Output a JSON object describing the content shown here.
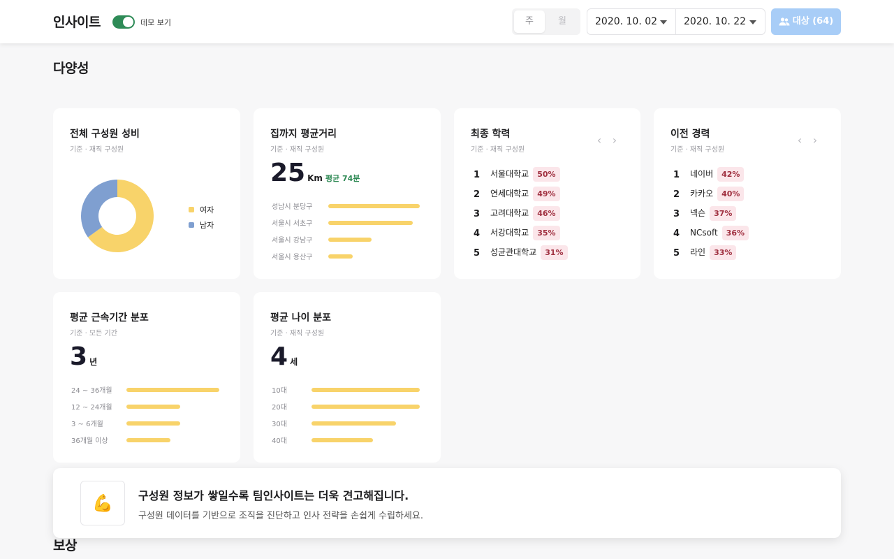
{
  "header": {
    "title": "인사이트",
    "demo_label": "데모 보기",
    "period_tabs": [
      "주",
      "월"
    ],
    "date_from": "2020. 10. 02",
    "date_to": "2020. 10. 22",
    "target_button": "대상 (64)",
    "accent_color": "#a8cdf7",
    "toggle_color": "#2e8b57"
  },
  "sections": {
    "diversity": "다양성",
    "compensation": "보상"
  },
  "gender_card": {
    "title": "전체 구성원 성비",
    "subtitle": "기준 · 재직 구성원",
    "chart_data": {
      "type": "pie",
      "categories": [
        "여자",
        "남자"
      ],
      "values": [
        65,
        35
      ],
      "colors": [
        "#f8d36a",
        "#7f9fd0"
      ]
    }
  },
  "distance_card": {
    "title": "집까지 평균거리",
    "subtitle": "기준 · 재직 구성원",
    "value": "25",
    "unit": "Km",
    "avg": "평균 74분",
    "chart_data": {
      "type": "bar",
      "categories": [
        "성남시 분당구",
        "서울시 서초구",
        "서울시 강남구",
        "서울시 용산구"
      ],
      "values": [
        100,
        92,
        47,
        27
      ]
    }
  },
  "education_card": {
    "title": "최종 학력",
    "subtitle": "기준 · 재직 구성원",
    "items": [
      {
        "rank": "1",
        "name": "서울대학교",
        "pct": "50%"
      },
      {
        "rank": "2",
        "name": "연세대학교",
        "pct": "49%"
      },
      {
        "rank": "3",
        "name": "고려대학교",
        "pct": "46%"
      },
      {
        "rank": "4",
        "name": "서강대학교",
        "pct": "35%"
      },
      {
        "rank": "5",
        "name": "성균관대학교",
        "pct": "31%"
      }
    ]
  },
  "career_card": {
    "title": "이전 경력",
    "subtitle": "기준 · 재직 구성원",
    "items": [
      {
        "rank": "1",
        "name": "네이버",
        "pct": "42%"
      },
      {
        "rank": "2",
        "name": "카카오",
        "pct": "40%"
      },
      {
        "rank": "3",
        "name": "넥슨",
        "pct": "37%"
      },
      {
        "rank": "4",
        "name": "NCsoft",
        "pct": "36%"
      },
      {
        "rank": "5",
        "name": "라인",
        "pct": "33%"
      }
    ]
  },
  "tenure_card": {
    "title": "평균 근속기간 분포",
    "subtitle": "기준 · 모든 기간",
    "value": "3",
    "unit": "년",
    "chart_data": {
      "type": "bar",
      "categories": [
        "24 ~ 36개월",
        "12 ~ 24개월",
        "3 ~ 6개월",
        "36개월 이상"
      ],
      "values": [
        100,
        58,
        58,
        47
      ]
    }
  },
  "age_card": {
    "title": "평균 나이 분포",
    "subtitle": "기준 · 재직 구성원",
    "value": "4",
    "unit": "세",
    "chart_data": {
      "type": "bar",
      "categories": [
        "10대",
        "20대",
        "30대",
        "40대"
      ],
      "values": [
        100,
        100,
        78,
        57
      ]
    }
  },
  "banner": {
    "icon": "flexed-biceps-icon",
    "emoji": "💪",
    "title": "구성원 정보가 쌓일수록 팀인사이트는 더욱 견고해집니다.",
    "description": "구성원 데이터를 기반으로 조직을 진단하고 인사 전략을 손쉽게 수립하세요."
  }
}
